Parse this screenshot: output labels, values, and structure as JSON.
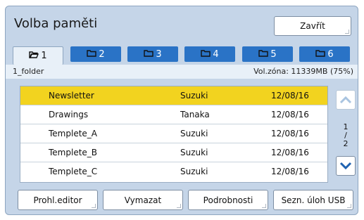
{
  "dialog": {
    "title": "Volba paměti",
    "close_label": "Zavřít"
  },
  "tabs": [
    {
      "label": "1",
      "active": true
    },
    {
      "label": "2",
      "active": false
    },
    {
      "label": "3",
      "active": false
    },
    {
      "label": "4",
      "active": false
    },
    {
      "label": "5",
      "active": false
    },
    {
      "label": "6",
      "active": false
    }
  ],
  "info": {
    "folder_name": "1_folder",
    "vol_zone": "Vol.zóna: 11339MB (75%)"
  },
  "table": {
    "rows": [
      {
        "name": "Newsletter",
        "owner": "Suzuki",
        "date": "12/08/16",
        "selected": true
      },
      {
        "name": "Drawings",
        "owner": "Tanaka",
        "date": "12/08/16",
        "selected": false
      },
      {
        "name": "Templete_A",
        "owner": "Suzuki",
        "date": "12/08/16",
        "selected": false
      },
      {
        "name": "Templete_B",
        "owner": "Suzuki",
        "date": "12/08/16",
        "selected": false
      },
      {
        "name": "Templete_C",
        "owner": "Suzuki",
        "date": "12/08/16",
        "selected": false
      }
    ]
  },
  "pager": {
    "current": "1",
    "separator": "/",
    "total": "2"
  },
  "actions": {
    "preview_editor": "Prohl.editor",
    "delete": "Vymazat",
    "details": "Podrobnosti",
    "usb_jobs": "Sezn. úloh USB"
  },
  "colors": {
    "accent": "#2a73c6",
    "selected_row": "#f2d31f",
    "panel": "#c5d5e8"
  },
  "icons": {
    "tab": "folder-icon",
    "scroll_up": "chevron-up-icon",
    "scroll_down": "chevron-down-icon"
  }
}
